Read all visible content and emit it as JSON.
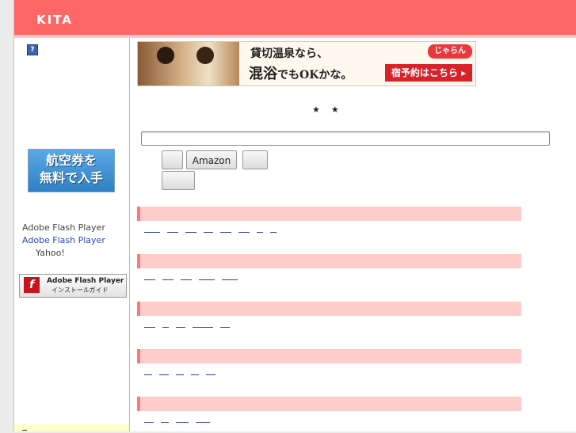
{
  "header": {
    "site_title": "KITA",
    "background": "#ff6666"
  },
  "sidebar": {
    "help_icon": "?",
    "air_banner": {
      "line1": "航空券を",
      "line2": "無料で入手"
    },
    "flash_text": {
      "line1": "Adobe Flash Player",
      "line2": "Adobe Flash Player",
      "line3": "Yahoo!"
    },
    "flash_badge": {
      "logo": "f",
      "title": "Adobe Flash Player",
      "subtitle": "インストールガイド"
    }
  },
  "ad_banner": {
    "text1": "貸切温泉なら、",
    "text2_big": "混浴",
    "text2_small": "でもOKかな。",
    "brand": "じゃらん",
    "cta": "宿予約はこちら ▸"
  },
  "search": {
    "stars": "★★",
    "input_value": "",
    "buttons": [
      "",
      "Amazon",
      "",
      ""
    ]
  },
  "sections": [
    {
      "links": [
        20,
        14,
        14,
        12,
        14,
        14,
        8,
        8
      ]
    },
    {
      "links": [
        14,
        14,
        14,
        20,
        20
      ]
    },
    {
      "links": [
        14,
        8,
        12,
        26,
        12
      ]
    },
    {
      "links": [
        10,
        12,
        10,
        10,
        12
      ]
    },
    {
      "links": [
        12,
        10,
        16,
        18
      ]
    }
  ],
  "colors": {
    "section_bar": "#ffcccc",
    "section_accent": "#ff7777",
    "link": "#2b3f9e"
  }
}
